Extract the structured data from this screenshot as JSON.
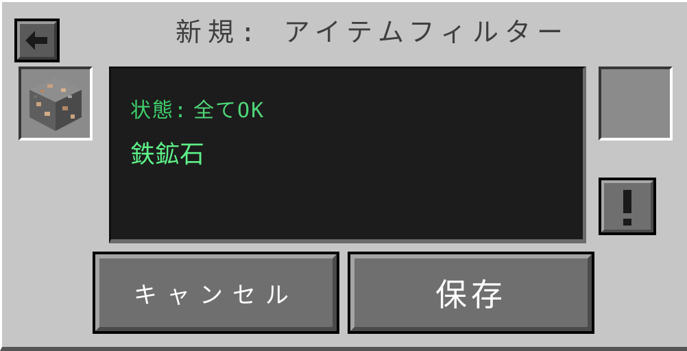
{
  "window": {
    "title": "新規: アイテムフィルター"
  },
  "screen": {
    "status_label": "状態:",
    "status_value": "全てOK",
    "item_name": "鉄鉱石"
  },
  "slots": {
    "input_item_icon": "iron-ore-block-icon",
    "output_item_icon": "empty"
  },
  "buttons": {
    "back_icon": "arrow-left-icon",
    "warning_icon": "exclamation-icon",
    "cancel_label": "キャンセル",
    "save_label": "保存"
  },
  "colors": {
    "panel_bg": "#c6c6c6",
    "screen_bg": "#1c1c1c",
    "status_green": "#3ecf6a",
    "item_green": "#5ef088",
    "button_bg": "#6f6f6f"
  }
}
